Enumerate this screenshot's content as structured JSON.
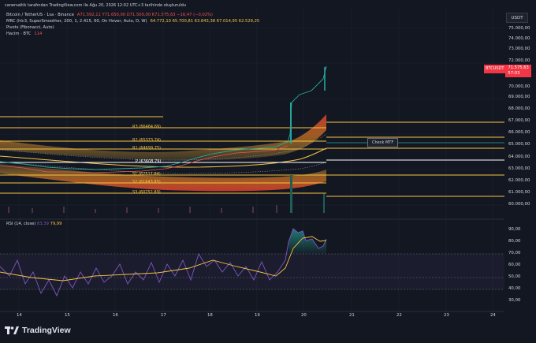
{
  "header": {
    "caption": "canersaltik tarafından TradingView.com ile Ağu 20, 2026 12:02 UTC+3 tarihinde oluşturuldu"
  },
  "legend": {
    "symbol": "Bitcoin / TetherUS · 1sa · Binance",
    "ohlc": "A71.592,11  Y71.650,00  D71.500,00  K71.575,63  −16,47 (−0,02%)",
    "mrc_name": "MRC (hlc3, SuperSmoother, 200, 1, 2.415, 60, On Hover, Auto, D, W)",
    "mrc_values": "64.772,10  65.700,81  63.843,38  67.014,95  62.529,25",
    "pivots_name": "Pivots (Fibonacci, Auto)",
    "volume_name": "Hacim · BTC",
    "volume_value": "114"
  },
  "price_axis": {
    "currency_button": "USDT",
    "labels": [
      "75.000,00",
      "74.000,00",
      "73.000,00",
      "72.000,00",
      "70.000,00",
      "69.000,00",
      "68.000,00",
      "67.000,00",
      "66.000,00",
      "65.000,00",
      "64.000,00",
      "63.000,00",
      "62.000,00",
      "61.000,00",
      "60.000,00"
    ],
    "current_symbol": "BTCUSDT",
    "current_price": "71.575,63",
    "countdown": "57:03"
  },
  "pivots": [
    {
      "label": "R3 (66464.69)",
      "color": "#f5c542"
    },
    {
      "label": "R2 (65373.74)",
      "color": "#f5c542"
    },
    {
      "label": "R1 (64699.75)",
      "color": "#f5c542"
    },
    {
      "label": "P (63608.79)",
      "color": "#ffffff"
    },
    {
      "label": "S1 (62517.84)",
      "color": "#f5c542"
    },
    {
      "label": "S2 (61843.85)",
      "color": "#f5c542"
    },
    {
      "label": "S3 (60752.89)",
      "color": "#f5c542"
    }
  ],
  "annotation": {
    "check_mtf": "Check MTF"
  },
  "rsi": {
    "name": "RSI (14, close)",
    "value1": "83,39",
    "value2": "79,99",
    "labels": [
      "90,00",
      "80,00",
      "70,00",
      "60,00",
      "50,00",
      "40,00",
      "30,00"
    ]
  },
  "x_axis": {
    "labels": [
      "14",
      "15",
      "16",
      "17",
      "18",
      "19",
      "20",
      "21",
      "22",
      "23",
      "24"
    ]
  },
  "brand": {
    "name": "TradingView"
  },
  "colors": {
    "background": "#131722",
    "up": "#26a69a",
    "down": "#ef5350",
    "pivot": "#f5c542",
    "rsi_line": "#7e57c2",
    "rsi_ma": "#f5c542",
    "price_tag": "#f23645"
  }
}
